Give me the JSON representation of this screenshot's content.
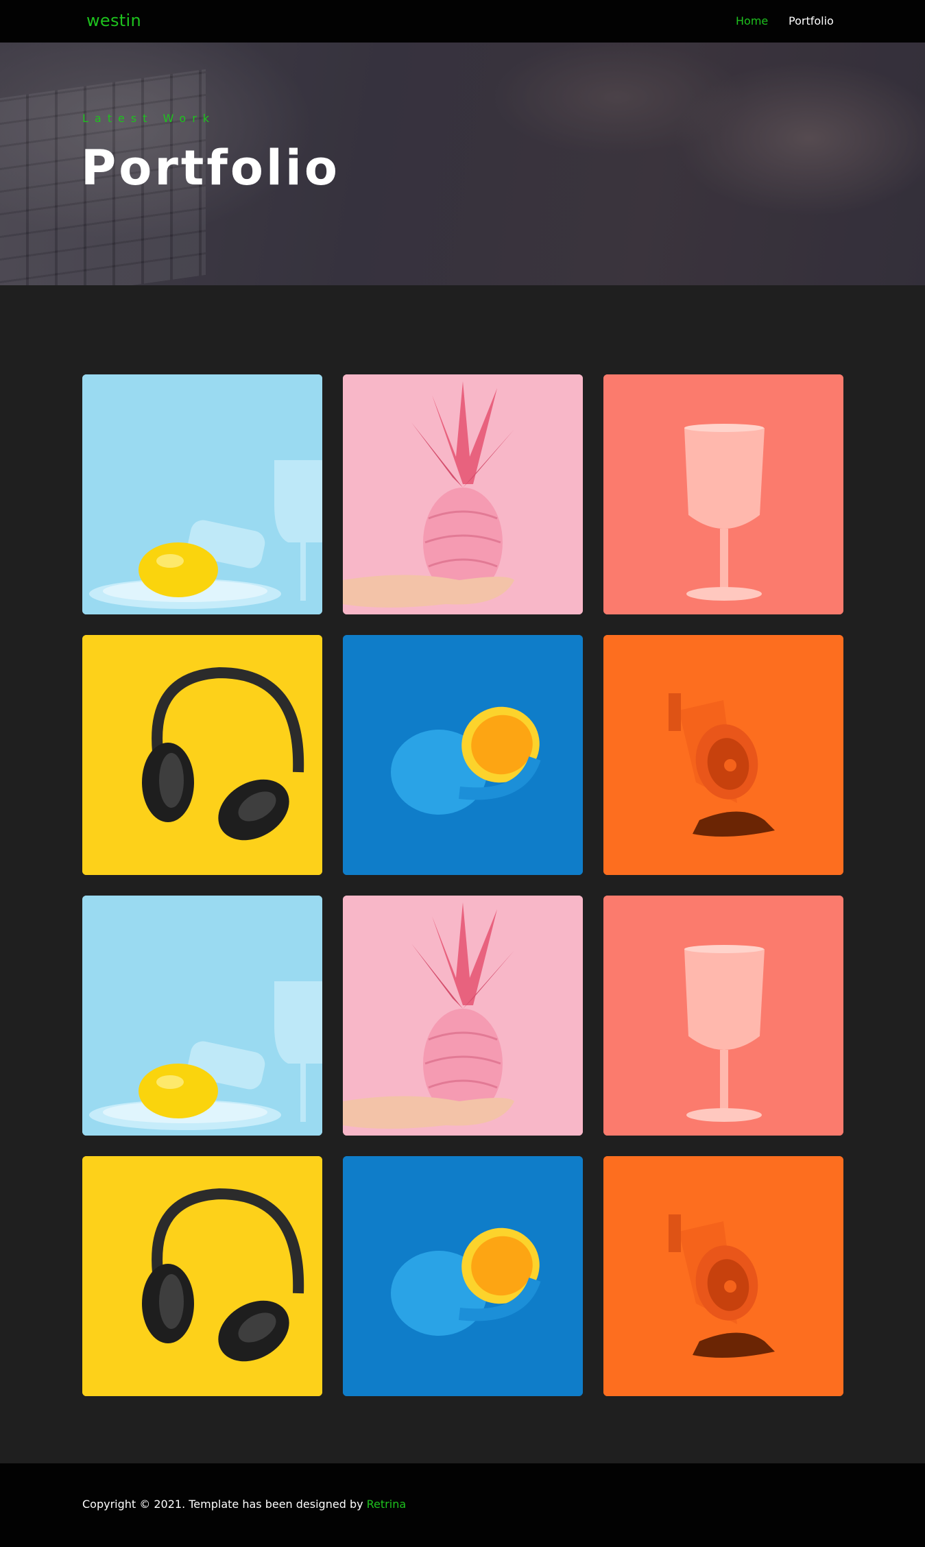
{
  "navbar": {
    "logo": "westin",
    "links": [
      {
        "label": "Home",
        "active": true
      },
      {
        "label": "Portfolio",
        "active": false
      }
    ]
  },
  "hero": {
    "eyebrow": "Latest Work",
    "title": "Portfolio"
  },
  "gallery": {
    "items": [
      {
        "subject": "lemon-and-glass",
        "background": "#a6dff3"
      },
      {
        "subject": "pink-pineapple",
        "background": "#f8b7c8"
      },
      {
        "subject": "pink-wine-glass",
        "background": "#fb7b6d"
      },
      {
        "subject": "black-headphones",
        "background": "#fdd11a"
      },
      {
        "subject": "blue-orange",
        "background": "#0f7dc9"
      },
      {
        "subject": "orange-megaphone",
        "background": "#fd6e1f"
      },
      {
        "subject": "lemon-and-glass",
        "background": "#a6dff3"
      },
      {
        "subject": "pink-pineapple",
        "background": "#f8b7c8"
      },
      {
        "subject": "pink-wine-glass",
        "background": "#fb7b6d"
      },
      {
        "subject": "black-headphones",
        "background": "#fdd11a"
      },
      {
        "subject": "blue-orange",
        "background": "#0f7dc9"
      },
      {
        "subject": "orange-megaphone",
        "background": "#fd6e1f"
      }
    ]
  },
  "footer": {
    "copyright_prefix": "Copyright © 2021. Template has been designed by ",
    "designer_link": "Retrina"
  },
  "colors": {
    "accent": "#1ec21e",
    "page_background": "#1f1f1f",
    "bar_background": "#020202"
  }
}
